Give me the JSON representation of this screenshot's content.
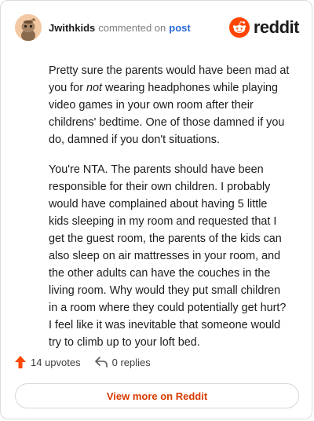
{
  "header": {
    "username": "Jwithkids",
    "commented_text": "commented on",
    "post_link": "post",
    "brand": "reddit"
  },
  "comment": {
    "p1_before": "Pretty sure the parents would have been mad at you for ",
    "p1_em": "not",
    "p1_after": " wearing headphones while playing video games in your own room after their childrens' bedtime. One of those damned if you do, damned if you don't situations.",
    "p2": "You're NTA. The parents should have been responsible for their own children. I probably would have complained about having 5 little kids sleeping in my room and requested that I get the guest room, the parents of the kids can also sleep on air mattresses in your room, and the other adults can have the couches in the living room. Why would they put small children in a room where they could potentially get hurt? I feel like it was inevitable that someone would try to climb up to your loft bed."
  },
  "actions": {
    "upvotes": "14 upvotes",
    "replies": "0 replies"
  },
  "footer": {
    "view_more": "View more on Reddit"
  },
  "colors": {
    "brand_orange": "#ff4500",
    "link_blue": "#2a6ad8",
    "view_more": "#d93a00"
  },
  "icons": {
    "avatar": "snoo-avatar",
    "brand": "reddit-logo-icon",
    "upvote": "upvote-arrow-icon",
    "reply": "reply-arrow-icon"
  }
}
